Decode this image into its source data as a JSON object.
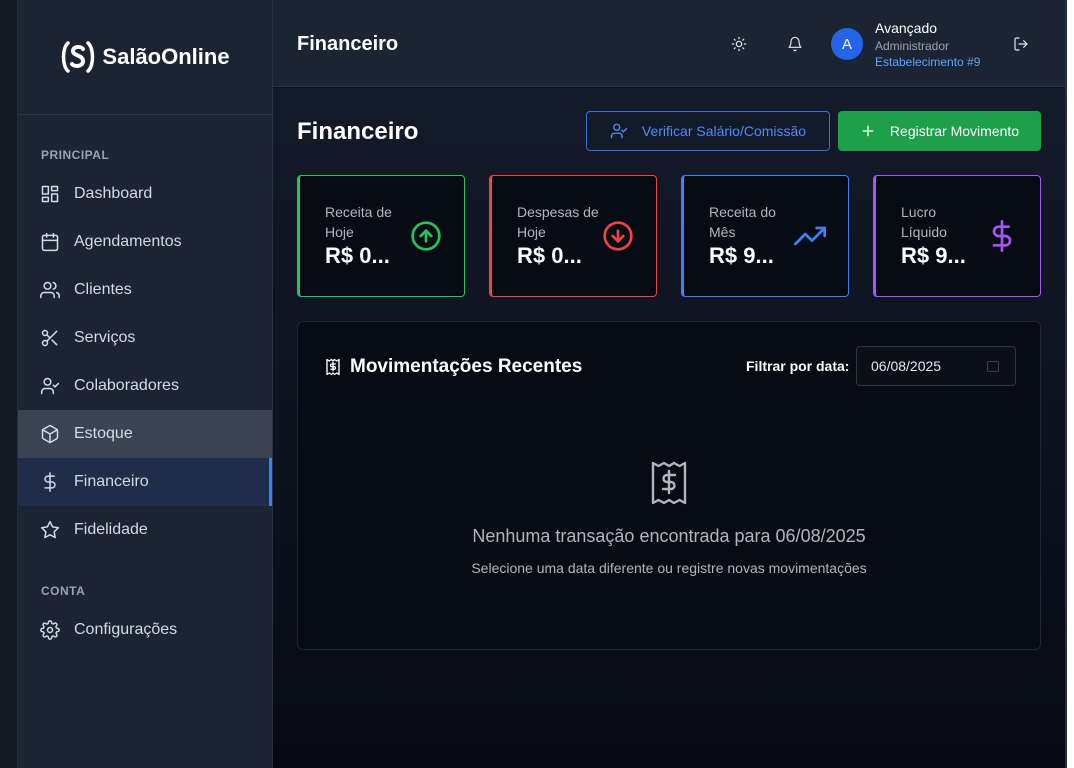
{
  "app": {
    "name": "SalãoOnline"
  },
  "sidebar": {
    "section_principal": "PRINCIPAL",
    "items": [
      {
        "label": "Dashboard",
        "icon": "dashboard-icon"
      },
      {
        "label": "Agendamentos",
        "icon": "calendar-icon"
      },
      {
        "label": "Clientes",
        "icon": "users-icon"
      },
      {
        "label": "Serviços",
        "icon": "scissors-icon"
      },
      {
        "label": "Colaboradores",
        "icon": "user-check-icon"
      },
      {
        "label": "Estoque",
        "icon": "box-icon",
        "state": "hover"
      },
      {
        "label": "Financeiro",
        "icon": "dollar-icon",
        "state": "active"
      },
      {
        "label": "Fidelidade",
        "icon": "star-icon"
      }
    ],
    "section_conta": "CONTA",
    "conta_items": [
      {
        "label": "Configurações",
        "icon": "gear-icon"
      }
    ]
  },
  "header": {
    "title": "Financeiro",
    "user": {
      "initial": "A",
      "name": "Avançado",
      "role": "Administrador",
      "establishment": "Estabelecimento #9"
    }
  },
  "page": {
    "title": "Financeiro",
    "btn_verify": "Verificar Salário/Comissão",
    "btn_register": "Registrar Movimento"
  },
  "cards": [
    {
      "label": "Receita de Hoje",
      "value": "R$ 0...",
      "icon": "arrow-up-circle-icon",
      "color": "#22c55e"
    },
    {
      "label": "Despesas de Hoje",
      "value": "R$ 0...",
      "icon": "arrow-down-circle-icon",
      "color": "#ef4444"
    },
    {
      "label": "Receita do Mês",
      "value": "R$ 9...",
      "icon": "trending-up-icon",
      "color": "#3b82f6"
    },
    {
      "label": "Lucro Líquido",
      "value": "R$ 9...",
      "icon": "dollar-icon",
      "color": "#a855f7"
    }
  ],
  "transactions": {
    "title": "Movimentações Recentes",
    "filter_label": "Filtrar por data:",
    "filter_value": "06/08/2025",
    "empty_title": "Nenhuma transação encontrada para 06/08/2025",
    "empty_subtitle": "Selecione uma data diferente ou registre novas movimentações"
  }
}
